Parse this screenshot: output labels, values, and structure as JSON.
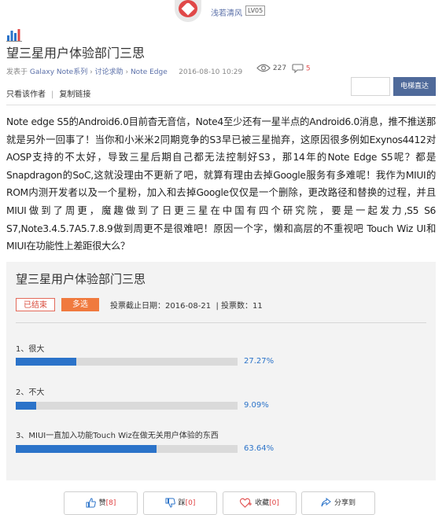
{
  "author": {
    "name": "浅若清风",
    "level": "LV05"
  },
  "post": {
    "title": "望三星用户体验部门三思",
    "meta_prefix": "发表于",
    "forum": "Galaxy Note系列",
    "category_sep": "›",
    "category": "讨论求助",
    "subcategory": "Note Edge",
    "date": "2016-08-10 10:29",
    "views": "227",
    "comments": "5",
    "only_author": "只看该作者",
    "copy_link": "复制链接",
    "body": "Note edge S5的Android6.0目前杳无音信，Note4至少还有一星半点的Android6.0消息，推不推送那就是另外一回事了！当你和小米米2同期竞争的S3早已被三星抛弃，这原因很多例如Exynos4412对AOSP支持的不太好，导致三星后期自己都无法控制好S3，那14年的Note Edge S5呢？都是Snapdragon的SoC,这就没理由不更新了吧，就算有理由去掉Google服务有多难呢！我作为MIUI的ROM内测开发者以及一个星粉，加入和去掉Google仅仅是一个删除，更改路径和替换的过程，并且MIUI做到了周更，魔趣做到了日更三星在中国有四个研究院，要是一起发力,S5 S6 S7,Note3.4.5.7A5.7.8.9做到周更不是很难吧！原因一个字，懒和高层的不重视吧 Touch Wiz UI和MIUI在功能性上差距很大么？"
  },
  "search": {
    "button": "电梯直达",
    "placeholder": ""
  },
  "poll": {
    "title": "望三星用户体验部门三思",
    "status": "已结束",
    "type": "多选",
    "deadline_label": "投票截止日期：",
    "deadline": "2016-08-21",
    "count_label": "| 投票数：",
    "count": "11",
    "options": [
      {
        "label": "1、很大",
        "percent": 27.27,
        "percent_text": "27.27%"
      },
      {
        "label": "2、不大",
        "percent": 9.09,
        "percent_text": "9.09%"
      },
      {
        "label": "3、MIUI一直加入功能Touch Wiz在做无关用户体验的东西",
        "percent": 63.64,
        "percent_text": "63.64%"
      }
    ]
  },
  "actions": {
    "like_label": "赞",
    "like_count": "[8]",
    "dislike_label": "踩",
    "dislike_count": "[0]",
    "favorite_label": "收藏",
    "favorite_count": "[0]",
    "share_label": "分享到"
  },
  "colors": {
    "accent": "#2b73c9",
    "button": "#4f6a9a",
    "multi_tag": "#f07a3e",
    "ended_tag": "#e36a5a"
  }
}
